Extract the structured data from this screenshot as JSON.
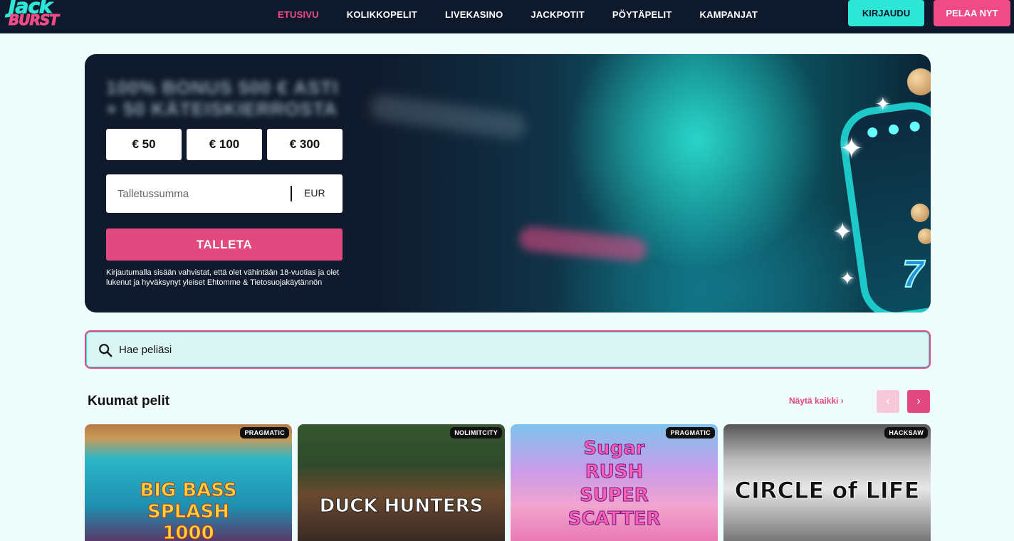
{
  "header": {
    "logo_top": "Jack",
    "logo_bottom": "BURST",
    "nav": [
      "ETUSIVU",
      "KOLIKKOPELIT",
      "LIVEKASINO",
      "JACKPOTIT",
      "PÖYTÄPELIT",
      "KAMPANJAT"
    ],
    "login_label": "KIRJAUDU",
    "play_label": "PELAA NYT"
  },
  "hero": {
    "bonus_line1": "100% BONUS 500 € ASTI",
    "bonus_line2": "+ 50 KÄTEISKIERROSTA",
    "amounts": [
      "€ 50",
      "€ 100",
      "€ 300"
    ],
    "deposit_placeholder": "Talletussumma",
    "currency": "EUR",
    "deposit_button": "TALLETA",
    "legal": "Kirjautumalla sisään vahvistat, että olet vähintään 18-vuotias ja olet lukenut ja hyväksynyt yleiset Ehtomme & Tietosuojakäytännön",
    "slot_symbol": "7"
  },
  "search": {
    "placeholder": "Hae peliäsi"
  },
  "section": {
    "title": "Kuumat pelit",
    "see_all": "Näytä kaikki ›",
    "prev_arrow": "‹",
    "next_arrow": "›"
  },
  "games": [
    {
      "provider": "PRAGMATIC",
      "title": "BIG BASS SPLASH 1000"
    },
    {
      "provider": "NOLIMITCITY",
      "title": "DUCK HUNTERS"
    },
    {
      "provider": "PRAGMATIC",
      "title": "Sugar RUSH SUPER SCATTER"
    },
    {
      "provider": "HACKSAW",
      "title": "CIRCLE of LIFE"
    }
  ],
  "colors": {
    "brand_teal": "#2ee6d6",
    "brand_pink": "#e2497f",
    "nav_bg": "#0e1a2b"
  }
}
